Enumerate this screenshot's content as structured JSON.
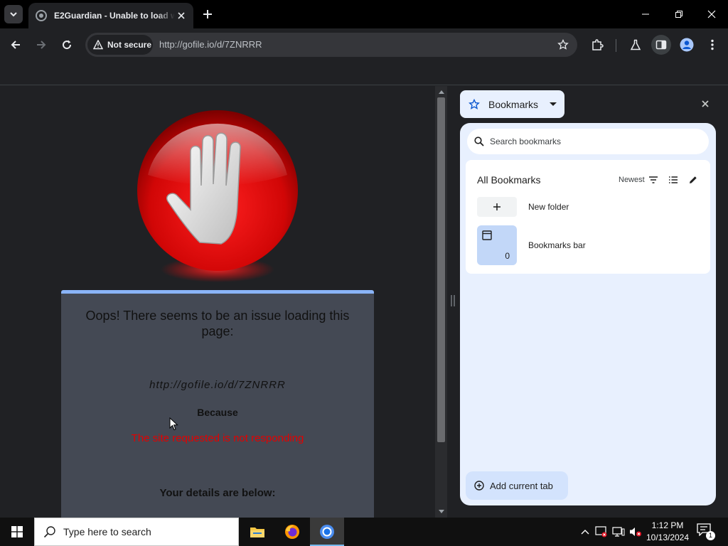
{
  "tabs": [
    {
      "title": "E2Guardian - Unable to load w"
    }
  ],
  "omnibox": {
    "security_label": "Not secure",
    "url": "http://gofile.io/d/7ZNRRR"
  },
  "page": {
    "heading": "Oops! There seems to be an issue loading this page:",
    "url": "http://gofile.io/d/7ZNRRR",
    "because": "Because",
    "reason": "The site requested is not responding",
    "details": "Your details are below:"
  },
  "side_panel": {
    "selector_label": "Bookmarks",
    "search_placeholder": "Search bookmarks",
    "header_title": "All Bookmarks",
    "sort_label": "Newest",
    "new_folder_label": "New folder",
    "folder": {
      "name": "Bookmarks bar",
      "count": "0"
    },
    "add_tab_label": "Add current tab"
  },
  "taskbar": {
    "search_placeholder": "Type here to search",
    "time": "1:12 PM",
    "date": "10/13/2024",
    "notification_count": "1"
  },
  "colors": {
    "accent": "#8ab4f8",
    "error_text": "#e30000",
    "panel_bg": "#e8f0fe"
  }
}
